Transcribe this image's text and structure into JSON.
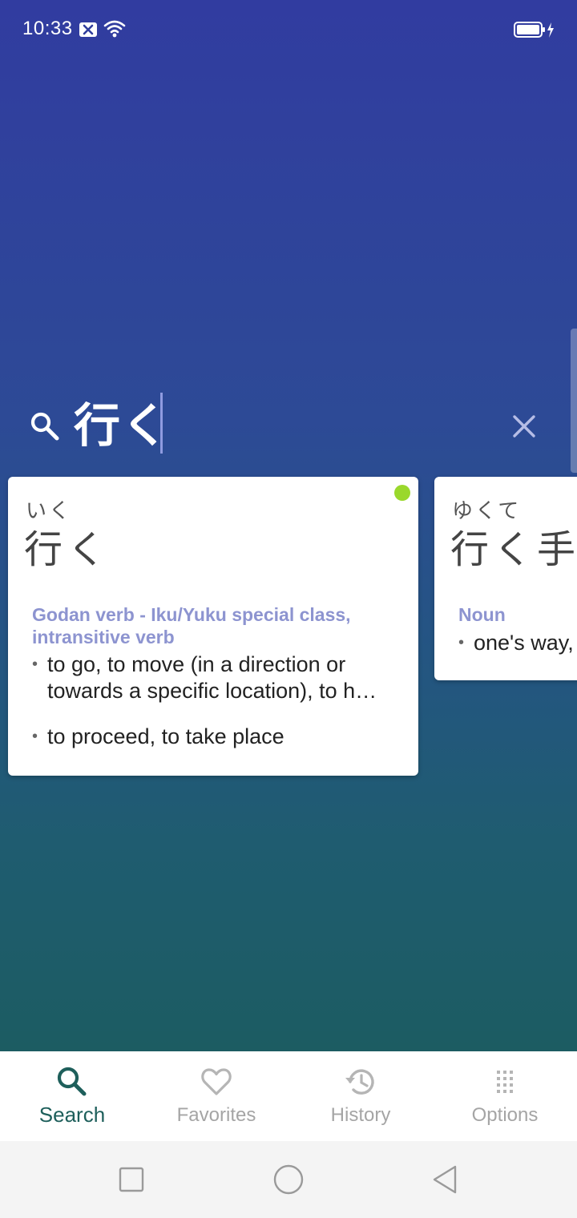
{
  "status_bar": {
    "time": "10:33"
  },
  "search": {
    "query": "行く"
  },
  "results": [
    {
      "reading": "いく",
      "headword": "行く",
      "pos": "Godan verb - Iku/Yuku special class, intransitive verb",
      "senses": [
        "to go, to move (in a direction or towards a specific location), to h…",
        "to proceed, to take place"
      ]
    },
    {
      "reading": "ゆくて",
      "headword": "行く手",
      "pos": "Noun",
      "senses": [
        "one's way,"
      ]
    }
  ],
  "bottom_nav": {
    "items": [
      {
        "label": "Search",
        "icon": "search-icon",
        "active": true
      },
      {
        "label": "Favorites",
        "icon": "heart-icon",
        "active": false
      },
      {
        "label": "History",
        "icon": "history-icon",
        "active": false
      },
      {
        "label": "Options",
        "icon": "grid-dots-icon",
        "active": false
      }
    ]
  },
  "colors": {
    "accent": "#1e5f5b",
    "pos_label": "#8d94d0",
    "new_indicator": "#9ad82c",
    "inactive_nav": "#a5a5a5"
  }
}
